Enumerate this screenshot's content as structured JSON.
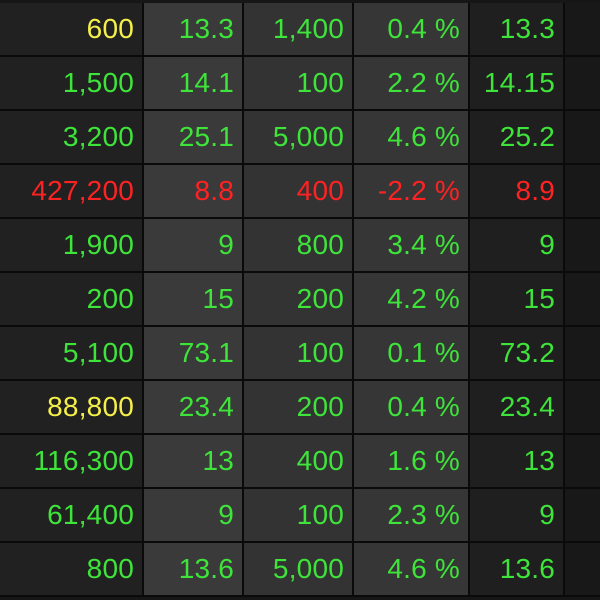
{
  "colors": {
    "up": "#3ee43a",
    "down": "#ff2222",
    "yellow": "#f4f04a"
  },
  "rows": [
    {
      "cells": [
        "600",
        "13.3",
        "1,400",
        "0.4 %",
        "13.3"
      ],
      "colors": [
        "yellow",
        "up",
        "up",
        "up",
        "up"
      ]
    },
    {
      "cells": [
        "1,500",
        "14.1",
        "100",
        "2.2 %",
        "14.15"
      ],
      "colors": [
        "up",
        "up",
        "up",
        "up",
        "up"
      ]
    },
    {
      "cells": [
        "3,200",
        "25.1",
        "5,000",
        "4.6 %",
        "25.2"
      ],
      "colors": [
        "up",
        "up",
        "up",
        "up",
        "up"
      ]
    },
    {
      "cells": [
        "427,200",
        "8.8",
        "400",
        "-2.2 %",
        "8.9"
      ],
      "colors": [
        "down",
        "down",
        "down",
        "down",
        "down"
      ]
    },
    {
      "cells": [
        "1,900",
        "9",
        "800",
        "3.4 %",
        "9"
      ],
      "colors": [
        "up",
        "up",
        "up",
        "up",
        "up"
      ]
    },
    {
      "cells": [
        "200",
        "15",
        "200",
        "4.2 %",
        "15"
      ],
      "colors": [
        "up",
        "up",
        "up",
        "up",
        "up"
      ]
    },
    {
      "cells": [
        "5,100",
        "73.1",
        "100",
        "0.1 %",
        "73.2"
      ],
      "colors": [
        "up",
        "up",
        "up",
        "up",
        "up"
      ]
    },
    {
      "cells": [
        "88,800",
        "23.4",
        "200",
        "0.4 %",
        "23.4"
      ],
      "colors": [
        "yellow",
        "up",
        "up",
        "up",
        "up"
      ]
    },
    {
      "cells": [
        "116,300",
        "13",
        "400",
        "1.6 %",
        "13"
      ],
      "colors": [
        "up",
        "up",
        "up",
        "up",
        "up"
      ]
    },
    {
      "cells": [
        "61,400",
        "9",
        "100",
        "2.3 %",
        "9"
      ],
      "colors": [
        "up",
        "up",
        "up",
        "up",
        "up"
      ]
    },
    {
      "cells": [
        "800",
        "13.6",
        "5,000",
        "4.6 %",
        "13.6"
      ],
      "colors": [
        "up",
        "up",
        "up",
        "up",
        "up"
      ]
    }
  ]
}
